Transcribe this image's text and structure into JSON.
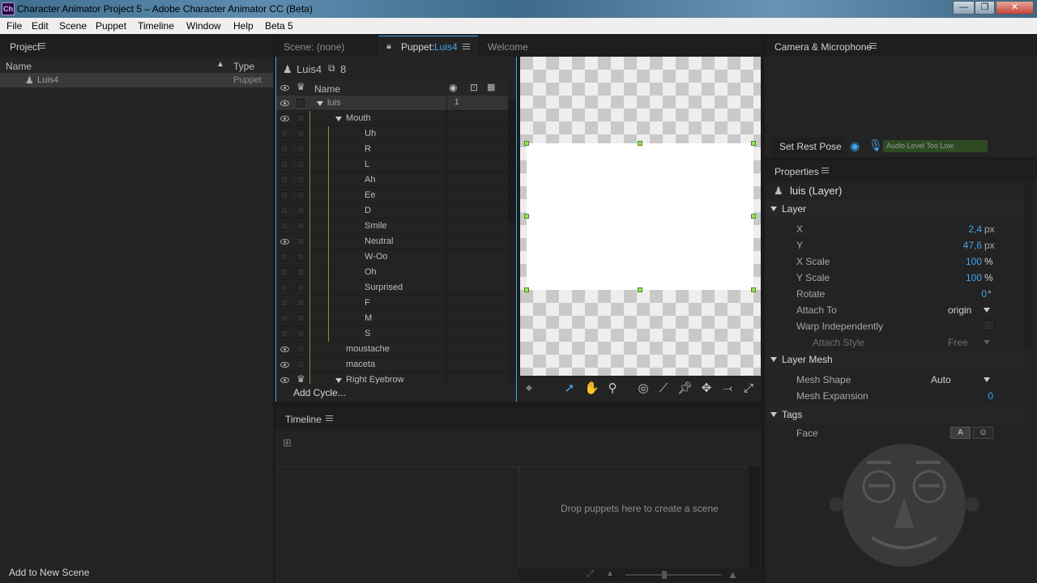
{
  "window": {
    "app_icon": "Ch",
    "title": "Character Animator Project 5 – Adobe Character Animator CC (Beta)",
    "controls": {
      "minimize": "—",
      "maximize": "❐",
      "close": "✕"
    }
  },
  "menu": [
    "File",
    "Edit",
    "Scene",
    "Puppet",
    "Timeline",
    "Window",
    "Help",
    "Beta 5"
  ],
  "project": {
    "title": "Project",
    "col_name": "Name",
    "col_type": "Type",
    "item_name": "Luis4",
    "item_type": "Puppet",
    "add_button": "Add to New Scene"
  },
  "tabs": [
    {
      "label": "Scene: (none)"
    },
    {
      "label_prefix": "Puppet: ",
      "label_name": "Luis4"
    },
    {
      "label": "Welcome"
    }
  ],
  "puppet": {
    "name": "Luis4",
    "count": "8",
    "col_name": "Name",
    "rows": [
      {
        "name": "luis",
        "value": "1"
      },
      {
        "name": "Mouth"
      },
      {
        "name": "Uh"
      },
      {
        "name": "R"
      },
      {
        "name": "L"
      },
      {
        "name": "Ah"
      },
      {
        "name": "Ee"
      },
      {
        "name": "D"
      },
      {
        "name": "Smile"
      },
      {
        "name": "Neutral"
      },
      {
        "name": "W-Oo"
      },
      {
        "name": "Oh"
      },
      {
        "name": "Surprised"
      },
      {
        "name": "F"
      },
      {
        "name": "M"
      },
      {
        "name": "S"
      },
      {
        "name": "moustache"
      },
      {
        "name": "maceta"
      },
      {
        "name": "Right Eyebrow"
      }
    ],
    "add_cycle": "Add Cycle..."
  },
  "camera": {
    "title": "Camera & Microphone",
    "rest_pose": "Set Rest Pose",
    "audio_level": "Audio Level Too Low"
  },
  "properties": {
    "title": "Properties",
    "layer_title": "luis (Layer)",
    "sections": {
      "layer": "Layer",
      "mesh": "Layer Mesh",
      "tags": "Tags"
    },
    "layer": {
      "x_label": "X",
      "x_value": "2,4",
      "x_unit": "px",
      "y_label": "Y",
      "y_value": "47,6",
      "y_unit": "px",
      "xscale_label": "X Scale",
      "xscale_value": "100",
      "xscale_unit": "%",
      "yscale_label": "Y Scale",
      "yscale_value": "100",
      "yscale_unit": "%",
      "rotate_label": "Rotate",
      "rotate_value": "0",
      "rotate_unit": "°",
      "attach_label": "Attach To",
      "attach_value": "origin",
      "warp_label": "Warp Independently",
      "attach_style_label": "Attach Style",
      "attach_style_value": "Free"
    },
    "mesh": {
      "shape_label": "Mesh Shape",
      "shape_value": "Auto",
      "expansion_label": "Mesh Expansion",
      "expansion_value": "0"
    },
    "tags": {
      "face_label": "Face",
      "text_btn": "A",
      "face_btn": "☺"
    }
  },
  "timeline": {
    "title": "Timeline",
    "drop_text": "Drop puppets here to create a scene"
  },
  "colors": {
    "accent": "#3fa8f0",
    "selection_handle": "#9ee25a",
    "audio_bar": "#2e4a22"
  }
}
